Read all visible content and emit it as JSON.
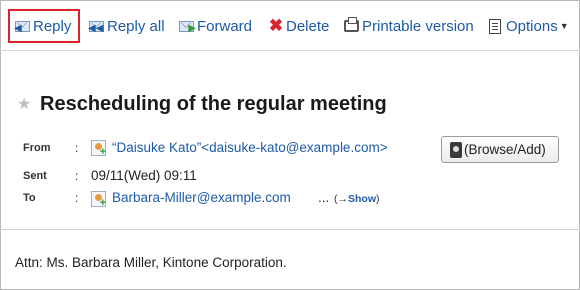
{
  "toolbar": {
    "reply": "Reply",
    "reply_all": "Reply all",
    "forward": "Forward",
    "delete": "Delete",
    "printable": "Printable version",
    "options": "Options"
  },
  "message": {
    "subject": "Rescheduling of the regular meeting",
    "from_label": "From",
    "from_value": "“Daisuke Kato”<daisuke-kato@example.com>",
    "browse_add": "(Browse/Add)",
    "sent_label": "Sent",
    "sent_value": "09/11(Wed) 09:11",
    "to_label": "To",
    "to_value": "Barbara-Miller@example.com",
    "to_more": "...",
    "show_open": "(→",
    "show_link": "Show",
    "show_close": ")",
    "colon": ":",
    "body": "Attn: Ms. Barbara Miller, Kintone Corporation."
  },
  "colors": {
    "link": "#1e5aa8",
    "highlight": "#d9262c",
    "delete": "#d9262c"
  },
  "icons": [
    "reply-icon",
    "reply-all-icon",
    "forward-icon",
    "delete-icon",
    "printer-icon",
    "options-icon",
    "star-icon",
    "user-add-icon",
    "address-book-icon"
  ]
}
